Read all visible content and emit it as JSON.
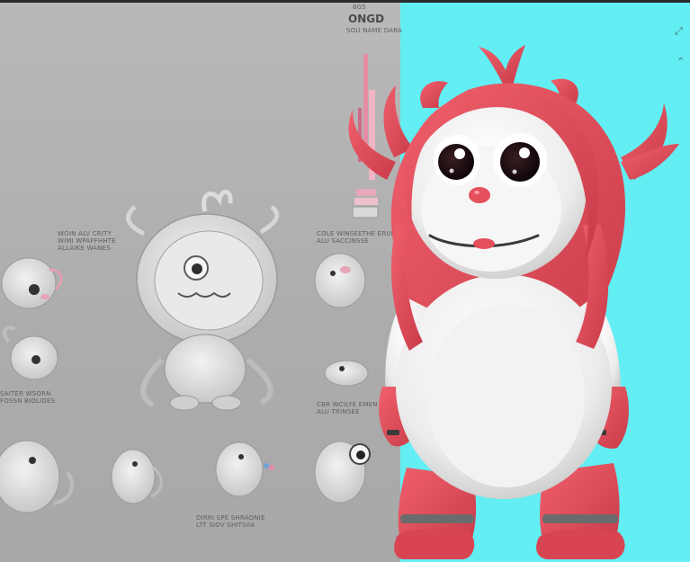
{
  "sheet": {
    "header_code": "ONGD",
    "header_small": "8G5",
    "header_sub": "SOU NAME DARA",
    "text_a": "WOIN ALV CRITY\nWIMI WPAFFHHTE\nALLAIKE WANES",
    "text_b": "COLE WINSEETHE ERUE\nALU SACCINSSE",
    "text_c": "CBR WCILYE EMEN\nALU TRINSEE",
    "text_d": "SAITER WSORN\nFOSSN BIOLIDES",
    "text_e": "DIRRI SPE SHRAONIE\nLTT SIOV SHITSIIA"
  },
  "colors": {
    "sheet_bg": "#b0b0b0",
    "panel_bg": "#62eef2",
    "mascot_red": "#e44c5a",
    "mascot_white": "#f4f4f4",
    "eye_dark": "#1c1013"
  },
  "icons": [
    "expand-icon",
    "chevron-up-icon"
  ]
}
